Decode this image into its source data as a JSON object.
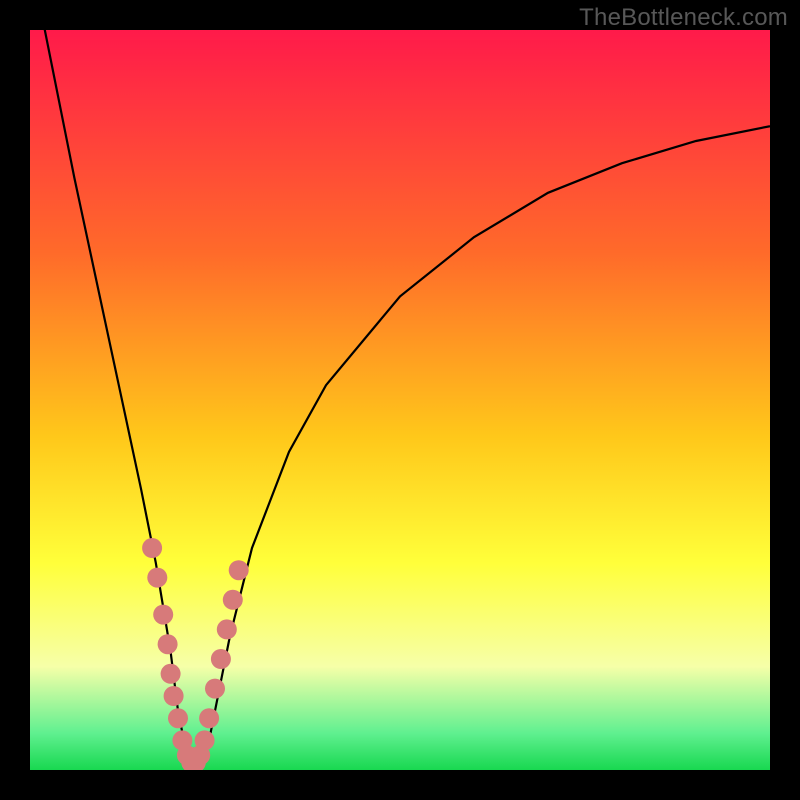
{
  "watermark": "TheBottleneck.com",
  "colors": {
    "top": "#ff1a4a",
    "upper_mid": "#ff7a2a",
    "mid": "#ffd21a",
    "lower_mid": "#ffff40",
    "pale": "#f8ffb0",
    "green": "#28e060",
    "black": "#000000",
    "dot": "#d77a7a"
  },
  "chart_data": {
    "type": "line",
    "title": "",
    "xlabel": "",
    "ylabel": "",
    "xlim": [
      0,
      100
    ],
    "ylim": [
      0,
      100
    ],
    "grid": false,
    "legend": false,
    "series": [
      {
        "name": "bottleneck-curve",
        "x": [
          0,
          3,
          6,
          9,
          12,
          15,
          17,
          19,
          20,
          21,
          22,
          23,
          24,
          25,
          27,
          30,
          35,
          40,
          50,
          60,
          70,
          80,
          90,
          100
        ],
        "y": [
          110,
          95,
          80,
          66,
          52,
          38,
          28,
          16,
          8,
          3,
          1,
          1,
          3,
          8,
          18,
          30,
          43,
          52,
          64,
          72,
          78,
          82,
          85,
          87
        ]
      }
    ],
    "scatter_points": {
      "name": "highlighted-points",
      "x": [
        16.5,
        17.2,
        18.0,
        18.6,
        19.0,
        19.4,
        20.0,
        20.6,
        21.2,
        21.8,
        22.4,
        23.0,
        23.6,
        24.2,
        25.0,
        25.8,
        26.6,
        27.4,
        28.2
      ],
      "y": [
        30,
        26,
        21,
        17,
        13,
        10,
        7,
        4,
        2,
        1,
        1,
        2,
        4,
        7,
        11,
        15,
        19,
        23,
        27
      ]
    },
    "gradient_stops": [
      {
        "pos": 0.0,
        "color": "#ff1a4a"
      },
      {
        "pos": 0.3,
        "color": "#ff6a2a"
      },
      {
        "pos": 0.55,
        "color": "#ffc81a"
      },
      {
        "pos": 0.72,
        "color": "#ffff3a"
      },
      {
        "pos": 0.86,
        "color": "#f6ffa8"
      },
      {
        "pos": 0.95,
        "color": "#60f090"
      },
      {
        "pos": 1.0,
        "color": "#18d850"
      }
    ]
  }
}
